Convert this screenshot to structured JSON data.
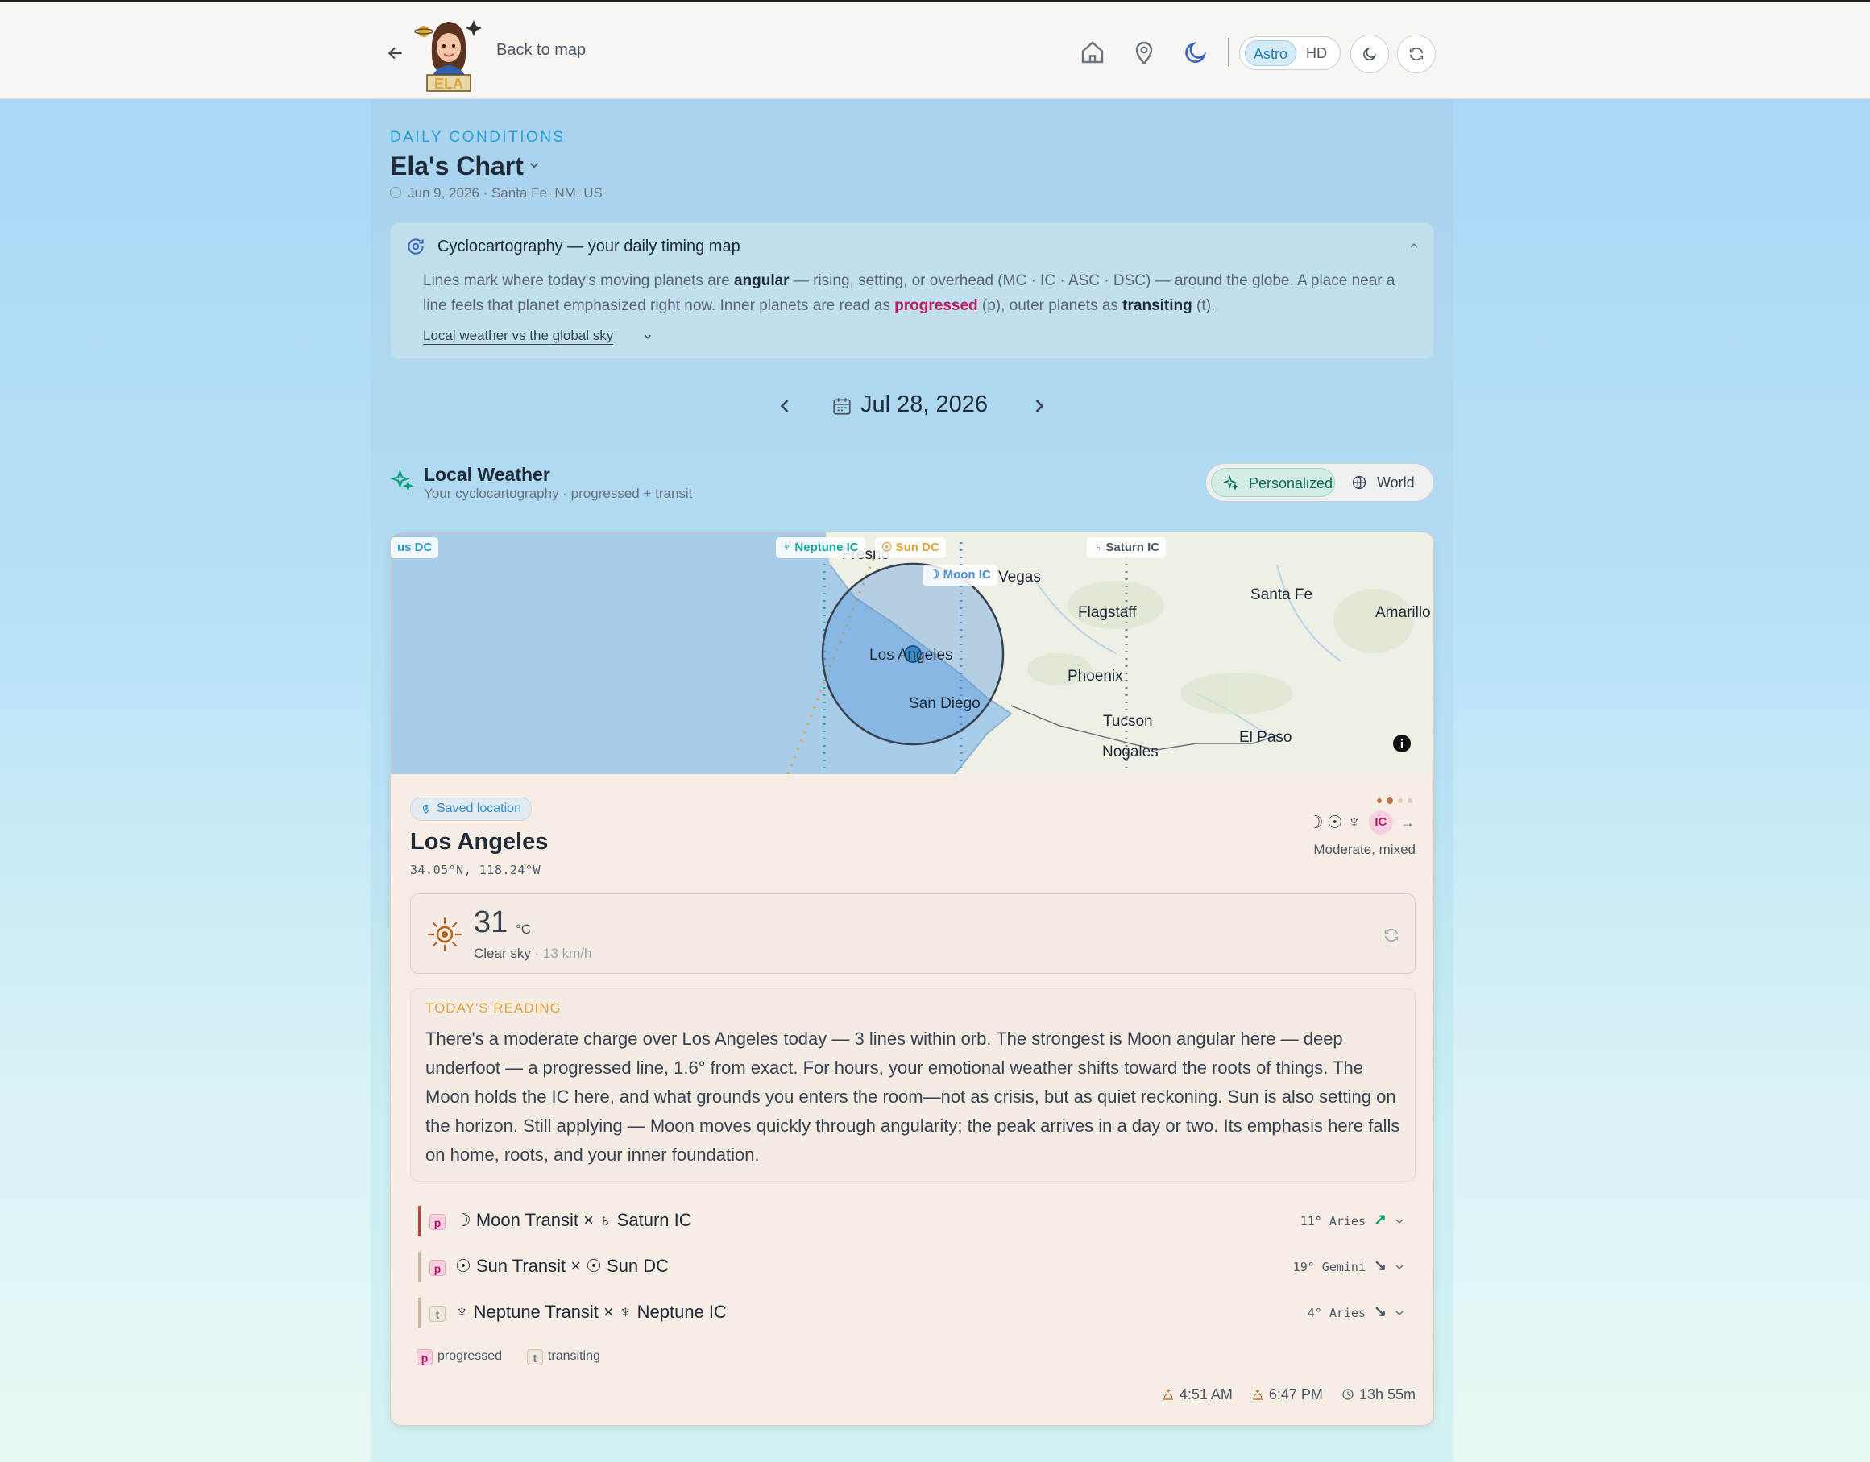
{
  "header": {
    "back_label": "Back to map",
    "logo_text": "ELA",
    "mode_options": [
      "Astro",
      "HD"
    ],
    "mode_selected": "Astro"
  },
  "page": {
    "eyebrow": "DAILY CONDITIONS",
    "title": "Ela's Chart",
    "subtitle": "Jun 9, 2026 · Santa Fe, NM, US"
  },
  "info": {
    "title": "Cyclocartography — your daily timing map",
    "body_1": "Lines mark where today's moving planets are ",
    "body_angular": "angular",
    "body_2": " — rising, setting, or overhead (MC · IC · ASC · DSC) — around the globe. A place near a line feels that planet emphasized right now. Inner planets are read as ",
    "body_progressed": "progressed",
    "body_3": " (p), outer planets as ",
    "body_transiting": "transiting",
    "body_4": " (t).",
    "link": "Local weather vs the global sky"
  },
  "date_nav": {
    "date": "Jul 28, 2026"
  },
  "local_weather": {
    "title": "Local Weather",
    "subtitle": "Your cyclocartography · progressed + transit",
    "toggle_personalized": "Personalized",
    "toggle_world": "World"
  },
  "map": {
    "tags": {
      "left_dc": "us DC",
      "neptune_ic": "♆ Neptune IC",
      "sun_dc": "☉ Sun DC",
      "moon_ic": "☽ Moon IC",
      "saturn_ic": "♄ Saturn IC"
    },
    "cities": {
      "fresno": "Fresno",
      "vegas": "Vegas",
      "santa_fe": "Santa Fe",
      "amarillo": "Amarillo",
      "flagstaff": "Flagstaff",
      "los_angeles": "Los Angeles",
      "phoenix": "Phoenix",
      "san_diego": "San Diego",
      "tucson": "Tucson",
      "el_paso": "El Paso",
      "nogales": "Nogales"
    },
    "colors": {
      "ocean": "#a9cce9",
      "land": "#eef0e6",
      "neptune": "#18a6a0",
      "sun": "#e0a33f",
      "moon": "#4a90d9",
      "saturn": "#6b7280"
    }
  },
  "location": {
    "badge": "Saved location",
    "city": "Los Angeles",
    "coords": "34.05°N, 118.24°W",
    "glyphs": [
      "☽",
      "☉",
      "♆"
    ],
    "angle_badge": "IC",
    "arrow": "→",
    "mood": "Moderate, mixed"
  },
  "weather": {
    "temp": "31",
    "unit": "°C",
    "condition": "Clear sky",
    "wind": "· 13 km/h"
  },
  "reading": {
    "tag": "TODAY'S READING",
    "text": "There's a moderate charge over Los Angeles today — 3 lines within orb. The strongest is Moon angular here — deep underfoot — a progressed line, 1.6° from exact. For hours, your emotional weather shifts toward the roots of things. The Moon holds the IC here, and what grounds you enters the room—not as crisis, but as quiet reckoning. Sun is also setting on the horizon. Still applying — Moon moves quickly through angularity; the peak arrives in a day or two. Its emphasis here falls on home, roots, and your inner foundation."
  },
  "aspects": [
    {
      "badge": "p",
      "label": "☽ Moon Transit × ♄ Saturn IC",
      "degree": "11° Aries",
      "trend": "↗",
      "trend_color": "#0f9d7a",
      "bar_color": "#b4443a"
    },
    {
      "badge": "p",
      "label": "☉ Sun Transit × ☉ Sun DC",
      "degree": "19° Gemini",
      "trend": "↘",
      "trend_color": "#4b5563",
      "bar_color": "#c9b8a8"
    },
    {
      "badge": "t",
      "label": "♆ Neptune Transit × ♆ Neptune IC",
      "degree": "4° Aries",
      "trend": "↘",
      "trend_color": "#4b5563",
      "bar_color": "#c9b8a8"
    }
  ],
  "legend": {
    "p": "progressed",
    "t": "transiting"
  },
  "sun_times": {
    "sunrise": "4:51 AM",
    "sunset": "6:47 PM",
    "daylight": "13h 55m"
  }
}
